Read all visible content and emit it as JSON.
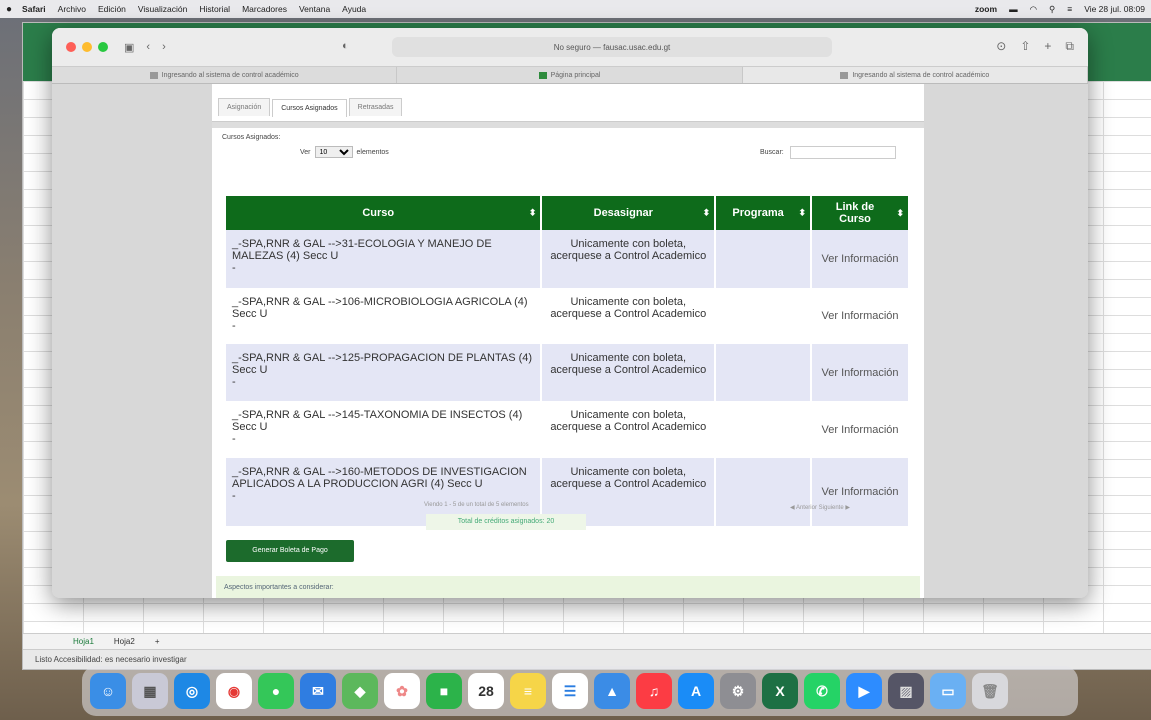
{
  "menubar": {
    "apple": "",
    "items": [
      "Safari",
      "Archivo",
      "Edición",
      "Visualización",
      "Historial",
      "Marcadores",
      "Ventana",
      "Ayuda"
    ],
    "right_zoom": "zoom",
    "clock": "Vie 28 jul. 08:09"
  },
  "safari": {
    "url": "No seguro — fausac.usac.edu.gt",
    "tabs": [
      {
        "label": "Ingresando al sistema de control académico"
      },
      {
        "label": "Página principal"
      },
      {
        "label": "Ingresando al sistema de control académico"
      }
    ]
  },
  "page_tabs": [
    "Asignación",
    "Cursos Asignados",
    "Retrasadas"
  ],
  "controls": {
    "assigned_label": "Cursos Asignados:",
    "show_prefix": "Ver",
    "show_value": "10",
    "show_suffix": "elementos",
    "search_label": "Buscar:",
    "search_value": ""
  },
  "table": {
    "headers": [
      "Curso",
      "Desasignar",
      "Programa",
      "Link de Curso"
    ],
    "rows": [
      {
        "curso": "_-SPA,RNR & GAL -->31-ECOLOGIA Y MANEJO DE MALEZAS (4) Secc U",
        "dash": "-",
        "desasignar": "Unicamente con boleta, acerquese a Control Academico",
        "programa": "",
        "link": "Ver Información"
      },
      {
        "curso": "_-SPA,RNR & GAL -->106-MICROBIOLOGIA AGRICOLA (4) Secc U",
        "dash": "-",
        "desasignar": "Unicamente con boleta, acerquese a Control Academico",
        "programa": "",
        "link": "Ver Información"
      },
      {
        "curso": "_-SPA,RNR & GAL -->125-PROPAGACION DE PLANTAS (4) Secc U",
        "dash": "-",
        "desasignar": "Unicamente con boleta, acerquese a Control Academico",
        "programa": "",
        "link": "Ver Información"
      },
      {
        "curso": "_-SPA,RNR & GAL -->145-TAXONOMIA DE INSECTOS (4) Secc U",
        "dash": "-",
        "desasignar": "Unicamente con boleta, acerquese a Control Academico",
        "programa": "",
        "link": "Ver Información"
      },
      {
        "curso": "_-SPA,RNR & GAL -->160-METODOS DE INVESTIGACION APLICADOS A LA PRODUCCION AGRI (4) Secc U",
        "dash": "-",
        "desasignar": "Unicamente con boleta, acerquese a Control Academico",
        "programa": "",
        "link": "Ver Información"
      }
    ]
  },
  "footer": {
    "info": "Viendo 1 - 5 de un total de 5 elementos",
    "credits": "Total de créditos asignados: 20",
    "prev": "Anterior",
    "next": "Siguiente",
    "generate_button": "Generar Boleta de Pago",
    "note": "Aspectos importantes a considerar:"
  },
  "excel": {
    "sheet_tabs": [
      "Hoja1",
      "Hoja2"
    ],
    "status": "Listo   Accesibilidad: es necesario investigar"
  },
  "colors": {
    "header_green": "#0e6b1b",
    "row_highlight": "#e4e6f5",
    "button_green": "#1c6b2c"
  },
  "dock_icons": [
    "finder-icon",
    "launchpad-icon",
    "safari-icon",
    "chrome-icon",
    "messages-icon",
    "mail-icon",
    "maps-icon",
    "photos-icon",
    "facetime-icon",
    "calendar-icon",
    "notes-icon",
    "reminders-icon",
    "keynote-icon",
    "music-icon",
    "appstore-icon",
    "settings-icon",
    "excel-icon",
    "whatsapp-icon",
    "zoom-icon",
    "preview-icon",
    "folder-icon",
    "trash-icon"
  ],
  "calendar_day": "28"
}
